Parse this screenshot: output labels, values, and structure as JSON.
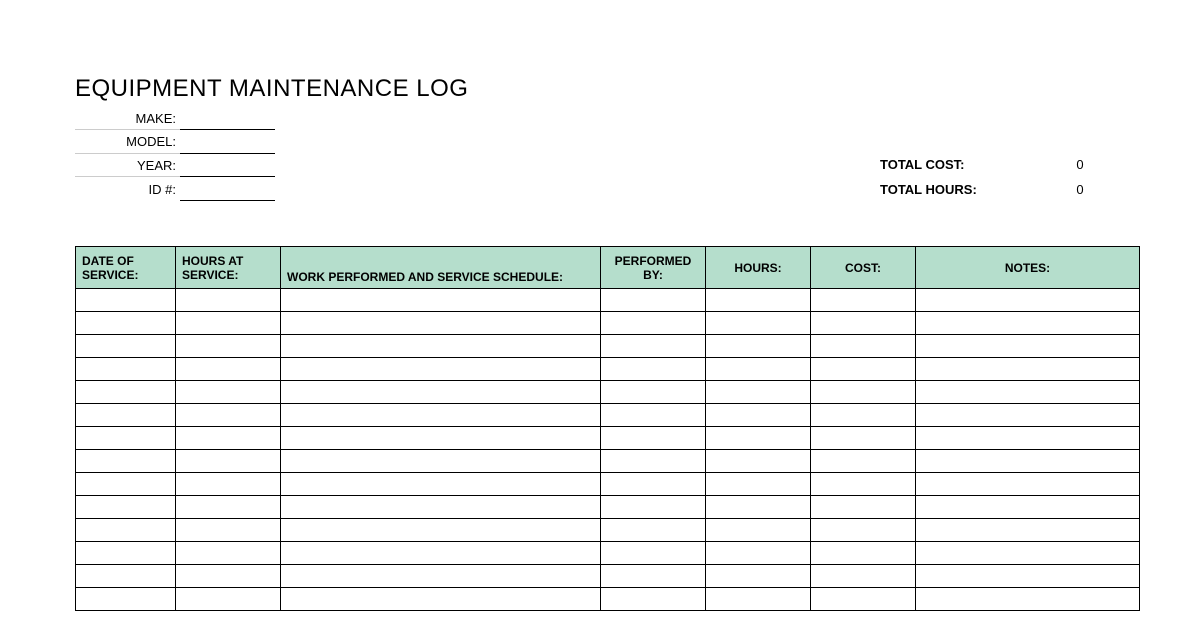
{
  "title": "EQUIPMENT MAINTENANCE LOG",
  "info": {
    "make_label": "MAKE:",
    "make_value": "",
    "model_label": "MODEL:",
    "model_value": "",
    "year_label": "YEAR:",
    "year_value": "",
    "id_label": "ID #:",
    "id_value": ""
  },
  "totals": {
    "cost_label": "TOTAL COST:",
    "cost_value": "0",
    "hours_label": "TOTAL HOURS:",
    "hours_value": "0"
  },
  "columns": {
    "date": "DATE OF SERVICE:",
    "hours_at": "HOURS AT SERVICE:",
    "work": "WORK PERFORMED AND SERVICE SCHEDULE:",
    "performed_by": "PERFORMED BY:",
    "hours": "HOURS:",
    "cost": "COST:",
    "notes": "NOTES:"
  },
  "rows": [
    {
      "date": "",
      "hours_at": "",
      "work": "",
      "performed_by": "",
      "hours": "",
      "cost": "",
      "notes": ""
    },
    {
      "date": "",
      "hours_at": "",
      "work": "",
      "performed_by": "",
      "hours": "",
      "cost": "",
      "notes": ""
    },
    {
      "date": "",
      "hours_at": "",
      "work": "",
      "performed_by": "",
      "hours": "",
      "cost": "",
      "notes": ""
    },
    {
      "date": "",
      "hours_at": "",
      "work": "",
      "performed_by": "",
      "hours": "",
      "cost": "",
      "notes": ""
    },
    {
      "date": "",
      "hours_at": "",
      "work": "",
      "performed_by": "",
      "hours": "",
      "cost": "",
      "notes": ""
    },
    {
      "date": "",
      "hours_at": "",
      "work": "",
      "performed_by": "",
      "hours": "",
      "cost": "",
      "notes": ""
    },
    {
      "date": "",
      "hours_at": "",
      "work": "",
      "performed_by": "",
      "hours": "",
      "cost": "",
      "notes": ""
    },
    {
      "date": "",
      "hours_at": "",
      "work": "",
      "performed_by": "",
      "hours": "",
      "cost": "",
      "notes": ""
    },
    {
      "date": "",
      "hours_at": "",
      "work": "",
      "performed_by": "",
      "hours": "",
      "cost": "",
      "notes": ""
    },
    {
      "date": "",
      "hours_at": "",
      "work": "",
      "performed_by": "",
      "hours": "",
      "cost": "",
      "notes": ""
    },
    {
      "date": "",
      "hours_at": "",
      "work": "",
      "performed_by": "",
      "hours": "",
      "cost": "",
      "notes": ""
    },
    {
      "date": "",
      "hours_at": "",
      "work": "",
      "performed_by": "",
      "hours": "",
      "cost": "",
      "notes": ""
    },
    {
      "date": "",
      "hours_at": "",
      "work": "",
      "performed_by": "",
      "hours": "",
      "cost": "",
      "notes": ""
    },
    {
      "date": "",
      "hours_at": "",
      "work": "",
      "performed_by": "",
      "hours": "",
      "cost": "",
      "notes": ""
    }
  ]
}
